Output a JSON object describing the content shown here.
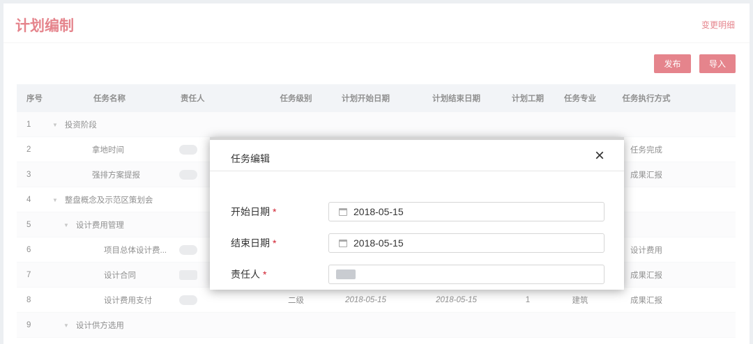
{
  "page": {
    "title": "计划编制",
    "change_link": "变更明细"
  },
  "toolbar": {
    "publish_label": "发布",
    "import_label": "导入"
  },
  "table": {
    "headers": [
      "序号",
      "任务名称",
      "责任人",
      "任务级别",
      "计划开始日期",
      "计划结束日期",
      "计划工期",
      "任务专业",
      "任务执行方式"
    ],
    "rows": [
      {
        "no": "1",
        "name": "投资阶段",
        "level": "",
        "start": "",
        "end": "",
        "days": "",
        "spec": "",
        "mode": ""
      },
      {
        "no": "2",
        "name": "拿地时间",
        "level": "",
        "start": "",
        "end": "",
        "days": "",
        "spec": "",
        "mode": "任务完成"
      },
      {
        "no": "3",
        "name": "强排方案提报",
        "level": "",
        "start": "",
        "end": "",
        "days": "",
        "spec": "",
        "mode": "成果汇报"
      },
      {
        "no": "4",
        "name": "整盘概念及示范区策划会",
        "level": "",
        "start": "",
        "end": "",
        "days": "",
        "spec": "",
        "mode": ""
      },
      {
        "no": "5",
        "name": "设计费用管理",
        "level": "",
        "start": "",
        "end": "",
        "days": "",
        "spec": "",
        "mode": ""
      },
      {
        "no": "6",
        "name": "项目总体设计费...",
        "level": "",
        "start": "",
        "end": "",
        "days": "",
        "spec": "",
        "mode": "设计费用"
      },
      {
        "no": "7",
        "name": "设计合同",
        "level": "",
        "start": "",
        "end": "",
        "days": "",
        "spec": "",
        "mode": "成果汇报"
      },
      {
        "no": "8",
        "name": "设计费用支付",
        "level": "二级",
        "start": "2018-05-15",
        "end": "2018-05-15",
        "days": "1",
        "spec": "建筑",
        "mode": "成果汇报"
      },
      {
        "no": "9",
        "name": "设计供方选用",
        "level": "",
        "start": "",
        "end": "",
        "days": "",
        "spec": "",
        "mode": ""
      }
    ]
  },
  "modal": {
    "title": "任务编辑",
    "close_symbol": "×",
    "start_label": "开始日期",
    "end_label": "结束日期",
    "owner_label": "责任人",
    "required_mark": "*",
    "start_value": "2018-05-15",
    "end_value": "2018-05-15"
  },
  "colors": {
    "accent": "#d0202f",
    "header_bg": "#e8ecf1"
  }
}
